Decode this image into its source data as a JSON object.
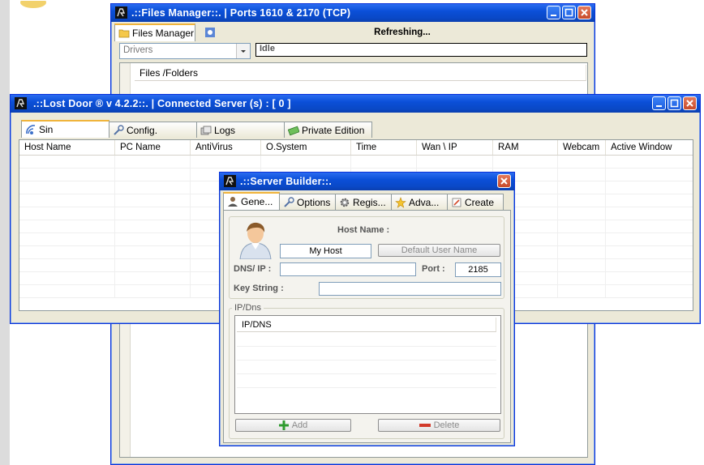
{
  "files_window": {
    "title": ".::Files Manager::.  |  Ports  1610 & 2170 (TCP)",
    "tab_label": "Files Manager",
    "status_text": "Refreshing...",
    "drive_combo_value": "Drivers",
    "path_value": "Idle",
    "column_header": "Files /Folders"
  },
  "main_window": {
    "title": ".::Lost Door ® v 4.2.2::. | Connected Server (s) : [ 0 ]",
    "tabs": [
      {
        "label": "Sin",
        "icon": "satellite-icon"
      },
      {
        "label": "Config.",
        "icon": "wrench-icon"
      },
      {
        "label": "Logs",
        "icon": "logs-icon"
      },
      {
        "label": "Private Edition",
        "icon": "money-icon"
      }
    ],
    "columns": [
      "Host Name",
      "PC Name",
      "AntiVirus",
      "O.System",
      "Time",
      "Wan \\ IP",
      "RAM",
      "Webcam",
      "Active Window"
    ]
  },
  "builder_window": {
    "title": ".::Server Builder::.",
    "tabs": [
      {
        "label": "Gene...",
        "icon": "user-icon"
      },
      {
        "label": "Options",
        "icon": "wrench-icon"
      },
      {
        "label": "Regis...",
        "icon": "gear-icon"
      },
      {
        "label": "Adva...",
        "icon": "star-icon"
      },
      {
        "label": "Create",
        "icon": "create-icon"
      }
    ],
    "host_name_label": "Host Name :",
    "host_name_value": "My Host",
    "default_user_button": "Default User Name",
    "dns_label": "DNS/ IP :",
    "dns_value": "",
    "port_label": "Port :",
    "port_value": "2185",
    "key_label": "Key String :",
    "key_value": "",
    "group_title": "IP/Dns",
    "list_header": "IP/DNS",
    "add_button": "Add",
    "delete_button": "Delete"
  }
}
